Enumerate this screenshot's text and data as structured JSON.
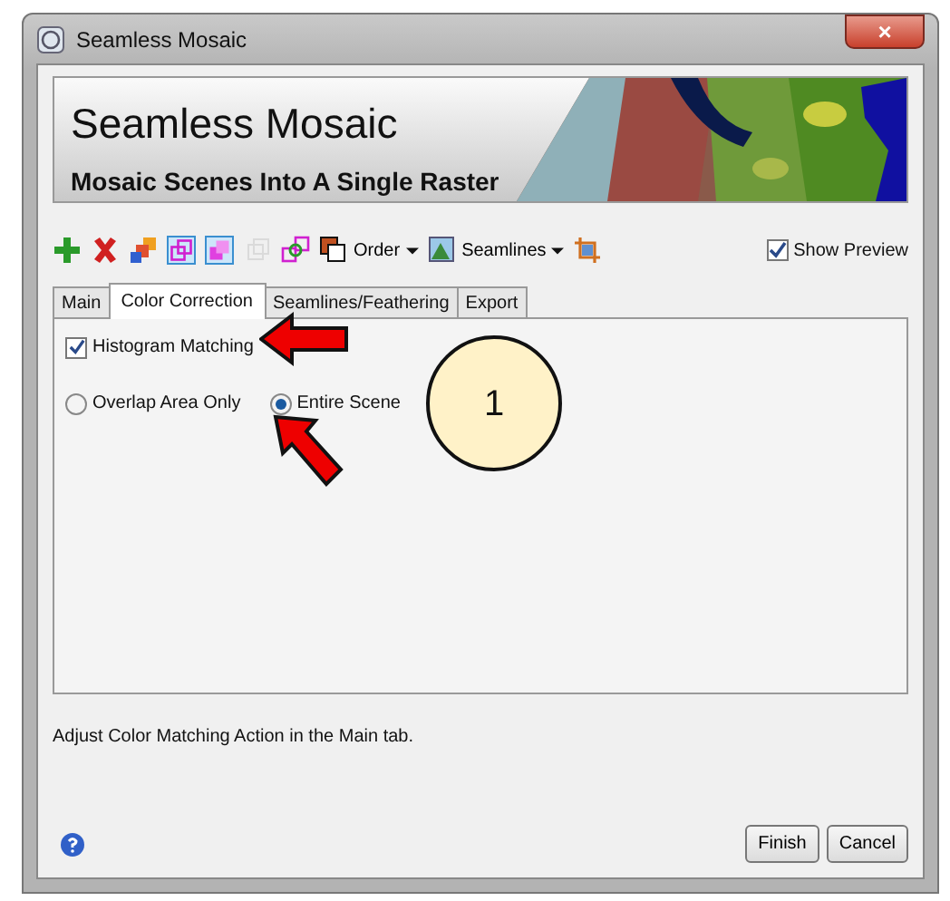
{
  "window": {
    "title": "Seamless Mosaic",
    "close": "×"
  },
  "header": {
    "title": "Seamless Mosaic",
    "subtitle": "Mosaic Scenes Into A Single Raster"
  },
  "toolbar": [
    {
      "kind": "add"
    },
    {
      "kind": "remove"
    },
    {
      "kind": "colors"
    },
    {
      "kind": "toggle",
      "selected": true
    },
    {
      "kind": "toggle2",
      "selected": true
    },
    {
      "kind": "ghost",
      "disabled": true
    },
    {
      "kind": "squares"
    },
    {
      "kind": "order",
      "label": "Order"
    },
    {
      "kind": "seam",
      "label": "Seamlines"
    },
    {
      "kind": "crop"
    }
  ],
  "show_preview": {
    "label": "Show Preview",
    "checked": true
  },
  "tabs": [
    {
      "label": "Main",
      "selected": false
    },
    {
      "label": "Color Correction",
      "selected": true
    },
    {
      "label": "Seamlines/Feathering",
      "selected": false
    },
    {
      "label": "Export",
      "selected": false
    }
  ],
  "panel": {
    "histogram": {
      "label": "Histogram Matching",
      "checked": true
    },
    "radios": [
      {
        "label": "Overlap Area Only",
        "selected": false
      },
      {
        "label": "Entire Scene",
        "selected": true
      }
    ]
  },
  "status": "Adjust Color Matching Action in the Main tab.",
  "buttons": [
    "Finish",
    "Cancel"
  ],
  "callout": {
    "label": "1"
  }
}
